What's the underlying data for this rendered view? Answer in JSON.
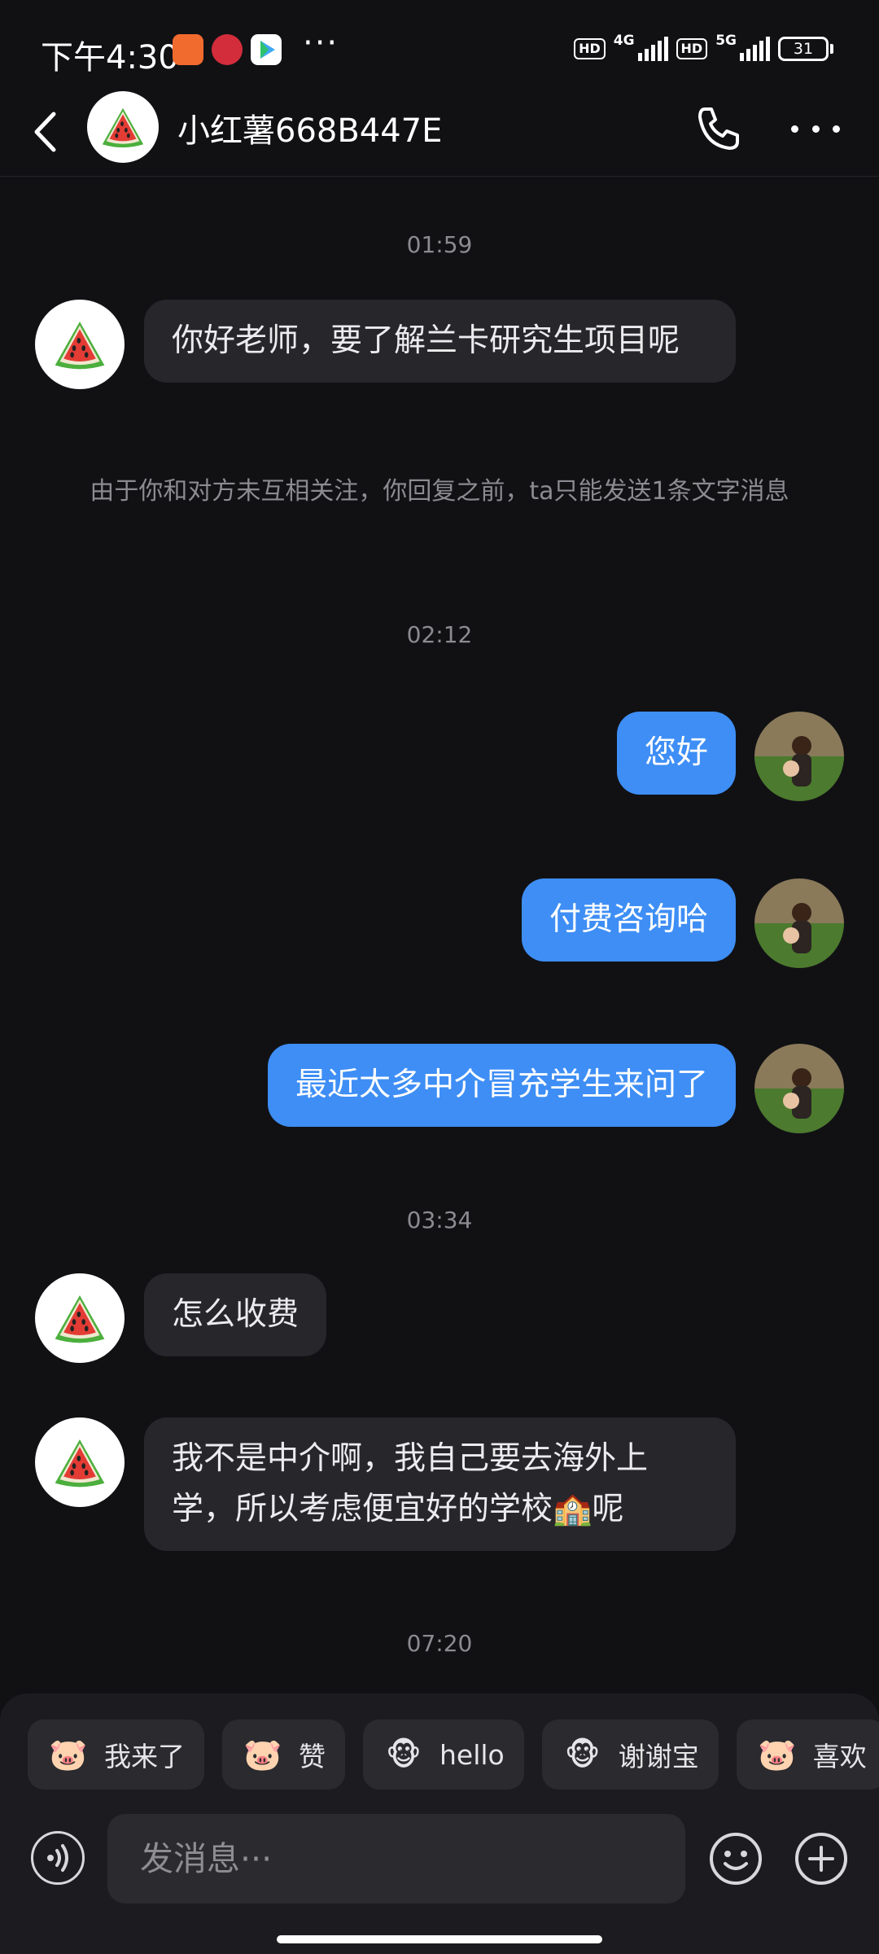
{
  "status": {
    "time": "下午4:30",
    "dots": "···",
    "hd1": "HD",
    "net1": "4G",
    "hd2": "HD",
    "net2": "5G",
    "battery": "31"
  },
  "header": {
    "title": "小红薯668B447E"
  },
  "messages": {
    "ts1": "01:59",
    "m1": "你好老师，要了解兰卡研究生项目呢",
    "notice": "由于你和对方未互相关注，你回复之前，ta只能发送1条文字消息",
    "ts2": "02:12",
    "m2": "您好",
    "m3": "付费咨询哈",
    "m4": "最近太多中介冒充学生来问了",
    "ts3": "03:34",
    "m5": "怎么收费",
    "m6": "我不是中介啊，我自己要去海外上学，所以考虑便宜好的学校🏫呢",
    "ts4": "07:20"
  },
  "quick_replies": [
    {
      "label": "我来了",
      "emoji": "🐷"
    },
    {
      "label": "赞",
      "emoji": "🐷"
    },
    {
      "label": "hello",
      "emoji": "🐵"
    },
    {
      "label": "谢谢宝",
      "emoji": "🐵"
    },
    {
      "label": "喜欢",
      "emoji": "🐷"
    }
  ],
  "input": {
    "placeholder": "发消息···"
  },
  "colors": {
    "background": "#111114",
    "outgoing_bubble": "#3e8ef5",
    "incoming_bubble": "#26262b"
  }
}
